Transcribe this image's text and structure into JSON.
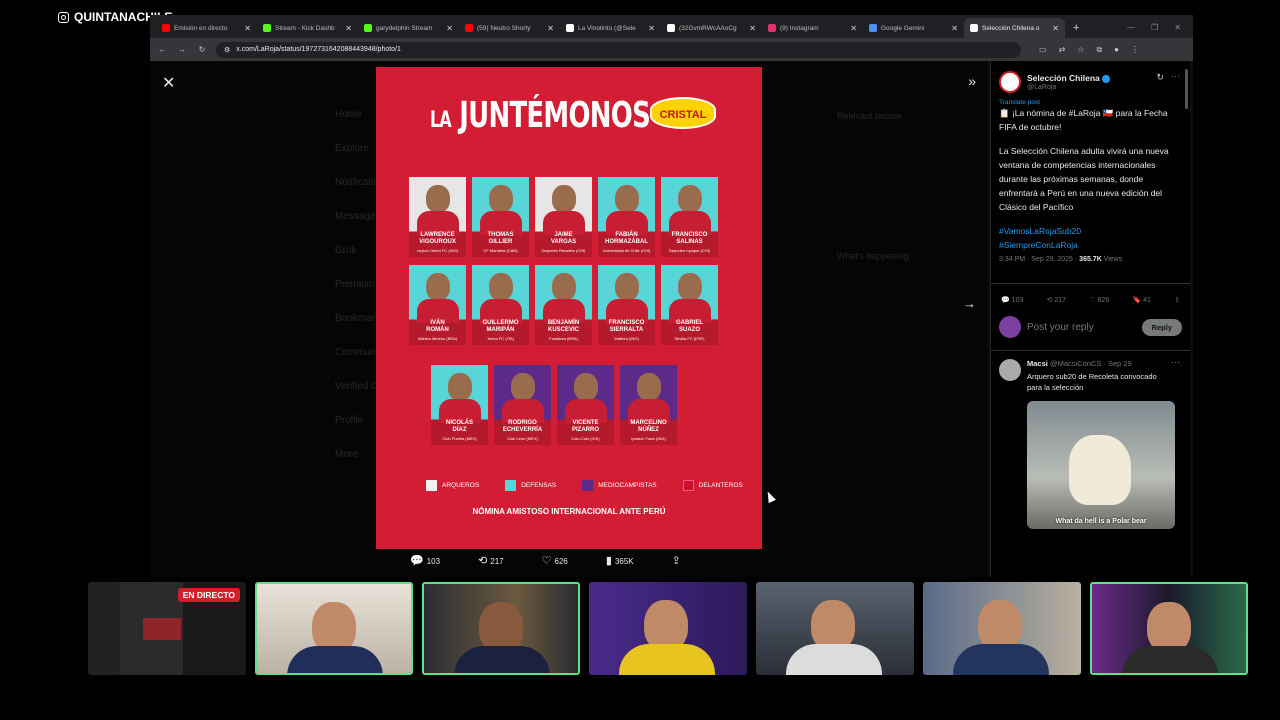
{
  "streamer": "QUINTANACHILE",
  "browser": {
    "tabs": [
      {
        "title": "Emisión en directo",
        "favicon_color": "#ff0000",
        "active": false
      },
      {
        "title": "Stream - Kick Dashb",
        "favicon_color": "#53fc18",
        "active": false
      },
      {
        "title": "garydelphin Stream",
        "favicon_color": "#53fc18",
        "active": false
      },
      {
        "title": "(59) Neutro Shorty",
        "favicon_color": "#ff0000",
        "active": false
      },
      {
        "title": "La Vinotinto (@Sele",
        "favicon_color": "#ffffff",
        "active": false
      },
      {
        "title": "(32GvmRWcAAoCg",
        "favicon_color": "#ffffff",
        "active": false
      },
      {
        "title": "(9) Instagram",
        "favicon_color": "#e1306c",
        "active": false
      },
      {
        "title": "Google Gemini",
        "favicon_color": "#4f8ff7",
        "active": false
      },
      {
        "title": "Selección Chilena o",
        "favicon_color": "#ffffff",
        "active": true
      }
    ],
    "url": "x.com/LaRoja/status/1972731642088443948/photo/1"
  },
  "poster": {
    "title_prefix": "LA",
    "title": "JUNTÉMONOS",
    "brand": "CRISTAL",
    "rows": [
      [
        {
          "name": "LAWRENCE\nVIGOUROUX",
          "club": "Leyton Orient FC (ING)",
          "pos": "gk"
        },
        {
          "name": "THOMAS\nGILLIER",
          "club": "CF Montréal (CAN)",
          "pos": "def"
        },
        {
          "name": "JAIME\nVARGAS",
          "club": "Deportes Recoleta (CHI)",
          "pos": "gk"
        },
        {
          "name": "FABIÁN\nHORMAZÁBAL",
          "club": "Universidad de Chile (CHI)",
          "pos": "def"
        },
        {
          "name": "FRANCISCO\nSALINAS",
          "club": "Deportes Iquique (CHI)",
          "pos": "def"
        }
      ],
      [
        {
          "name": "IVÁN\nROMÁN",
          "club": "Atlético Mineiro (BRA)",
          "pos": "def"
        },
        {
          "name": "GUILLERMO\nMARIPÁN",
          "club": "Torino FC (ITA)",
          "pos": "def"
        },
        {
          "name": "BENJAMÍN\nKUSCEVIC",
          "club": "Fortaleza (BRA)",
          "pos": "def"
        },
        {
          "name": "FRANCISCO\nSIERRALTA",
          "club": "Watford (ING)",
          "pos": "def"
        },
        {
          "name": "GABRIEL\nSUAZO",
          "club": "Sevilla FC (ESP)",
          "pos": "def"
        }
      ],
      [
        {
          "name": "NICOLÁS\nDÍAZ",
          "club": "Club Puebla (MEX)",
          "pos": "def"
        },
        {
          "name": "RODRIGO\nECHEVERRÍA",
          "club": "Club León (MEX)",
          "pos": "mid"
        },
        {
          "name": "VICENTE\nPIZARRO",
          "club": "Colo-Colo (CHI)",
          "pos": "mid"
        },
        {
          "name": "MARCELINO\nNÚÑEZ",
          "club": "Ipswich Town (ING)",
          "pos": "mid"
        }
      ]
    ],
    "legend": [
      {
        "label": "ARQUEROS",
        "color": "#f2f2f2"
      },
      {
        "label": "DEFENSAS",
        "color": "#58d6d7"
      },
      {
        "label": "MEDIOCAMPISTAS",
        "color": "#5b2a8a"
      },
      {
        "label": "DELANTEROS",
        "color": "#c9122c"
      }
    ],
    "footer": "NÓMINA AMISTOSO INTERNACIONAL ANTE PERÚ"
  },
  "media_actions": {
    "replies": "103",
    "reposts": "217",
    "likes": "626",
    "views": "365K"
  },
  "bg_page": {
    "nav": [
      "Home",
      "Explore",
      "Notifications",
      "Messages",
      "Grok",
      "Premium",
      "Bookmarks",
      "Communities",
      "Verified Orgs",
      "Profile",
      "More"
    ],
    "right": [
      "Relevant people",
      "What's happening"
    ]
  },
  "tweet": {
    "author": "Selección Chilena",
    "handle": "@LaRoja",
    "translate": "Translate post",
    "line1": "📋 ¡La nómina de #LaRoja 🇨🇱 para la Fecha FIFA de octubre!",
    "line2": "La Selección Chilena adulta vivirá una nueva ventana de competencias internacionales durante las próximas semanas, donde enfrentará a Perú en una nueva edición del Clásico del Pacífico",
    "hashtag1": "#VamosLaRojaSub20",
    "hashtag2": "#SiempreConLaRoja",
    "time": "3:34 PM · Sep 29, 2025 · ",
    "views": "365.7K",
    "views_label": " Views",
    "stats": {
      "replies": "103",
      "reposts": "217",
      "likes": "626",
      "bookmarks": "41"
    }
  },
  "reply_box": {
    "placeholder": "Post your reply",
    "button": "Reply"
  },
  "reply": {
    "author": "Macsi",
    "handle": "@MacsiConCS · Sep 29",
    "text": "Arquero sub20 de Recoleta convocado para la selección",
    "image_caption": "What da hell is a Polar bear"
  },
  "live_badge": "EN DIRECTO"
}
